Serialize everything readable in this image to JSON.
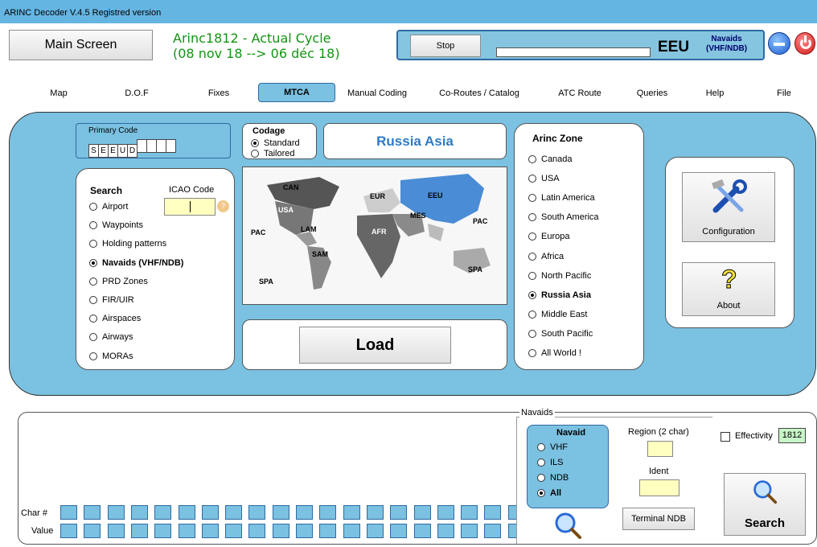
{
  "window": {
    "title": "ARINC Decoder V.4.5  Registred version"
  },
  "header": {
    "main_screen": "Main Screen",
    "cycle_line1": "Arinc1812 - Actual Cycle",
    "cycle_line2": "(08 nov 18 --> 06 déc 18)",
    "stop": "Stop",
    "zone_code": "EEU",
    "navaids_label_1": "Navaids",
    "navaids_label_2": "(VHF/NDB)"
  },
  "tabs": [
    "Map",
    "D.O.F",
    "Fixes",
    "MTCA",
    "Manual Coding",
    "Co-Routes / Catalog",
    "ATC Route",
    "Queries",
    "Help",
    "File"
  ],
  "primary_code": {
    "label": "Primary Code",
    "chars": [
      "S",
      "E",
      "E",
      "U",
      "D",
      "",
      "",
      "",
      ""
    ]
  },
  "codage": {
    "label": "Codage",
    "options": [
      "Standard",
      "Tailored"
    ],
    "selected": "Standard"
  },
  "region_title": "Russia Asia",
  "map": {
    "labels": [
      "CAN",
      "USA",
      "PAC",
      "LAM",
      "SAM",
      "SPA",
      "EUR",
      "EEU",
      "MES",
      "AFR",
      "PAC",
      "SPA"
    ]
  },
  "search": {
    "title": "Search",
    "icao_label": "ICAO Code",
    "options": [
      "Airport",
      "Waypoints",
      "Holding patterns",
      "Navaids (VHF/NDB)",
      "PRD Zones",
      "FIR/UIR",
      "Airspaces",
      "Airways",
      "MORAs"
    ],
    "selected": "Navaids (VHF/NDB)"
  },
  "load_button": "Load",
  "arinc_zone": {
    "title": "Arinc Zone",
    "options": [
      "Canada",
      "USA",
      "Latin America",
      "South America",
      "Europa",
      "Africa",
      "North Pacific",
      "Russia Asia",
      "Middle East",
      "South Pacific",
      "All World !"
    ],
    "selected": "Russia Asia"
  },
  "tools": {
    "configuration": "Configuration",
    "about": "About"
  },
  "bottom": {
    "char_label": "Char #",
    "value_label": "Value",
    "navaids_group": "Navaids",
    "navaid_title": "Navaid",
    "navaid_options": [
      "VHF",
      "ILS",
      "NDB",
      "All"
    ],
    "navaid_selected": "All",
    "region_label": "Region (2 char)",
    "ident_label": "Ident",
    "terminal_ndb": "Terminal NDB",
    "effectivity_label": "Effectivity",
    "effectivity_value": "1812",
    "search_button": "Search"
  },
  "colors": {
    "panel": "#7bc1e1",
    "title_bar": "#65b5e3",
    "cycle_text": "#129512",
    "region_title": "#2e7bc4"
  }
}
